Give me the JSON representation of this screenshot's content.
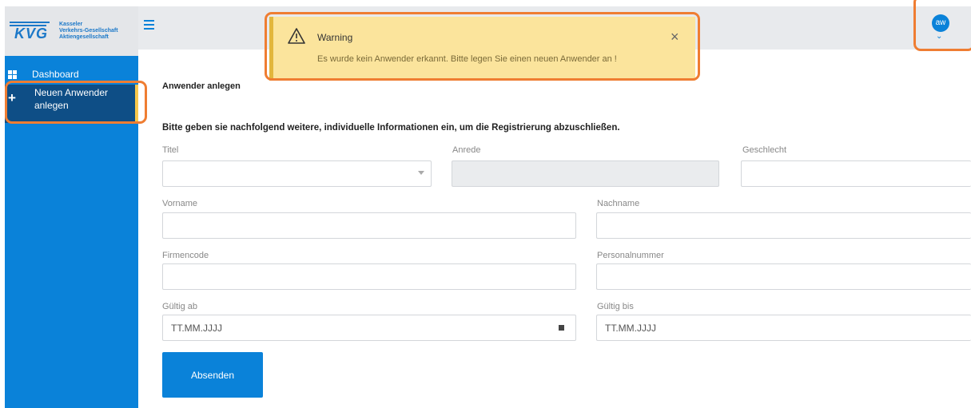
{
  "brand": {
    "logo_text": "KVG",
    "company_lines": [
      "Kasseler",
      "Verkehrs-Gesellschaft",
      "Aktiengesellschaft"
    ]
  },
  "sidebar": {
    "items": [
      {
        "label": "Dashboard",
        "icon": "dashboard-grid-icon"
      },
      {
        "label": "Neuen Anwender anlegen",
        "icon": "plus-icon",
        "active": true
      }
    ]
  },
  "header": {
    "menu_icon": "hamburger-menu-icon",
    "user_initials": "aw"
  },
  "warning": {
    "title": "Warning",
    "message": "Es wurde kein Anwender erkannt. Bitte legen Sie einen neuen Anwender an !",
    "close_symbol": "×"
  },
  "form": {
    "page_title": "Anwender anlegen",
    "instructions": "Bitte geben sie nachfolgend weitere, individuelle Informationen ein, um die Registrierung abzuschließen.",
    "fields": {
      "titel": {
        "label": "Titel",
        "value": ""
      },
      "anrede": {
        "label": "Anrede",
        "value": ""
      },
      "geschlecht": {
        "label": "Geschlecht",
        "value": ""
      },
      "vorname": {
        "label": "Vorname",
        "value": ""
      },
      "nachname": {
        "label": "Nachname",
        "value": ""
      },
      "firmencode": {
        "label": "Firmencode",
        "value": ""
      },
      "personalnummer": {
        "label": "Personalnummer",
        "value": ""
      },
      "gueltig_ab": {
        "label": "Gültig ab",
        "placeholder": "TT.MM.JJJJ"
      },
      "gueltig_bis": {
        "label": "Gültig bis",
        "placeholder": "TT.MM.JJJJ"
      }
    },
    "submit_label": "Absenden"
  },
  "colors": {
    "primary": "#0a82d9",
    "active_nav": "#0e4e86",
    "highlight": "#ef7d32",
    "warning_bg": "#fbe49c"
  }
}
